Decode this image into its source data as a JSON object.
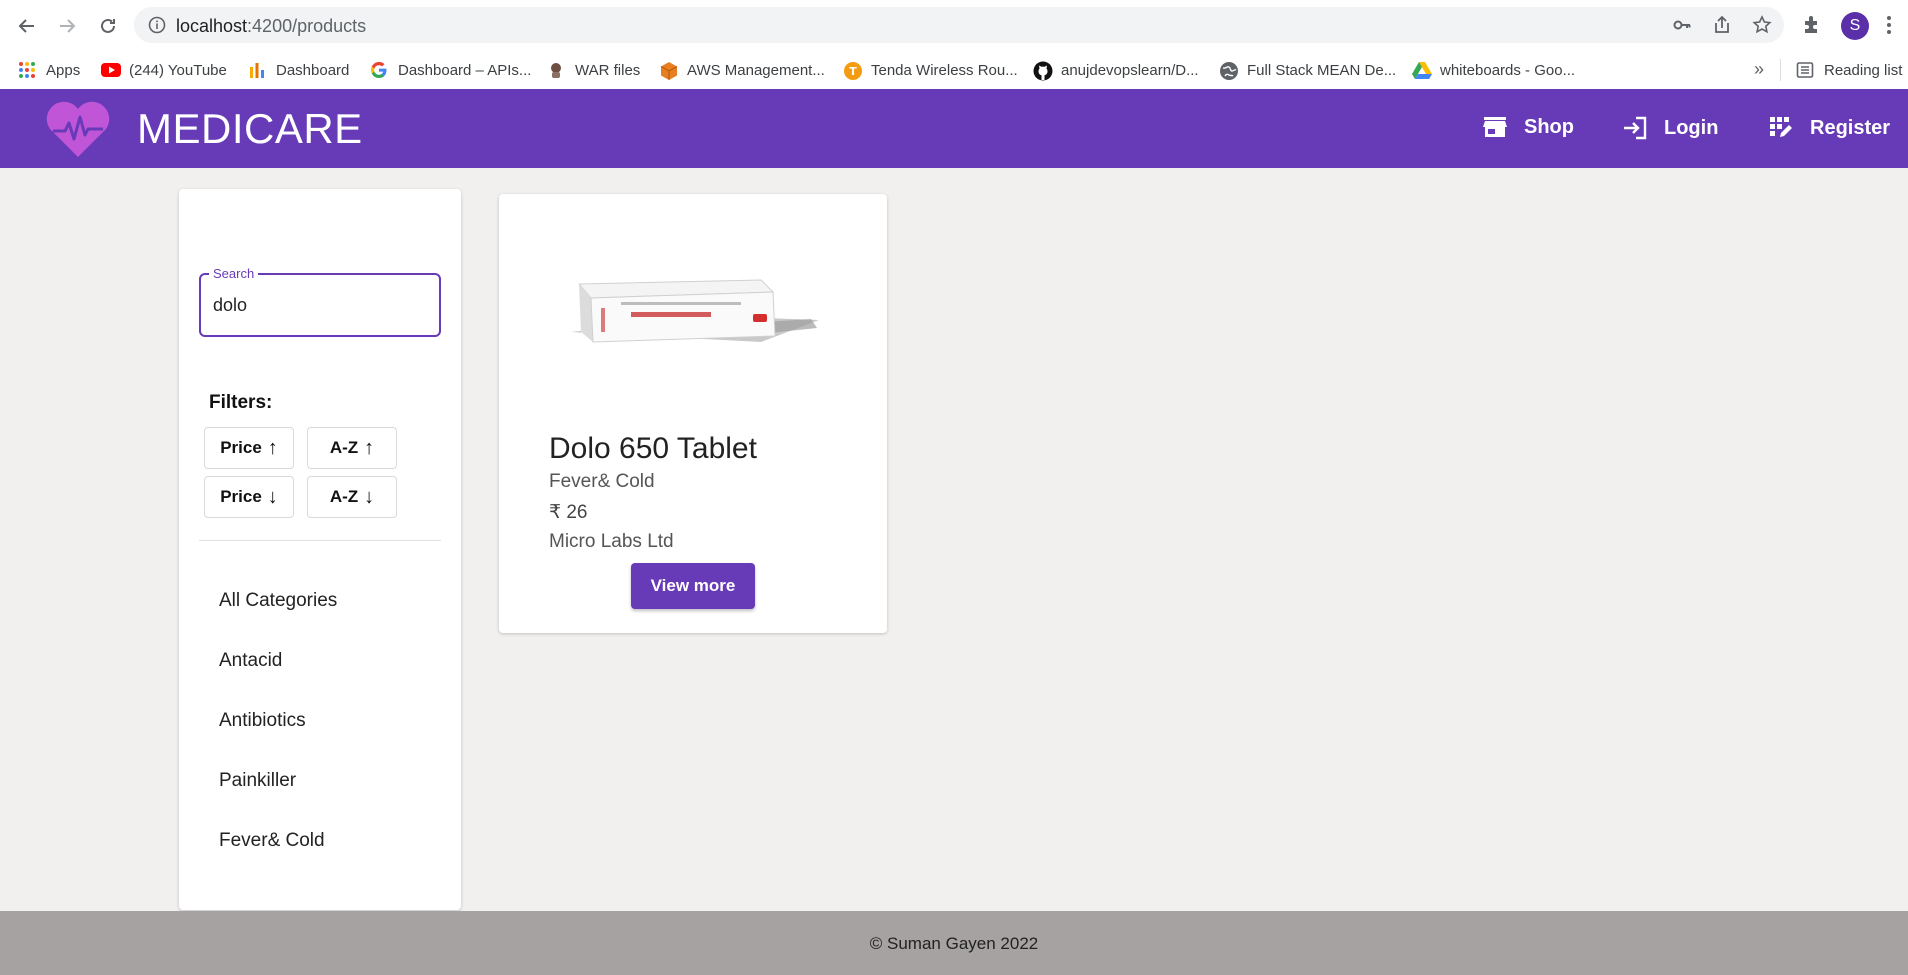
{
  "browser": {
    "url_host": "localhost",
    "url_path": ":4200/products",
    "bookmarks": [
      {
        "label": "Apps",
        "icon": "apps-grid-icon"
      },
      {
        "label": "(244) YouTube",
        "icon": "youtube-icon"
      },
      {
        "label": "Dashboard",
        "icon": "dashboard-icon"
      },
      {
        "label": "Dashboard – APIs...",
        "icon": "google-icon"
      },
      {
        "label": "WAR files",
        "icon": "war-files-icon"
      },
      {
        "label": "AWS Management...",
        "icon": "aws-icon"
      },
      {
        "label": "Tenda Wireless Rou...",
        "icon": "tenda-icon"
      },
      {
        "label": "anujdevopslearn/D...",
        "icon": "github-icon"
      },
      {
        "label": "Full Stack MEAN De...",
        "icon": "globe-icon"
      },
      {
        "label": "whiteboards - Goo...",
        "icon": "google-drive-icon"
      }
    ],
    "more_bookmarks": "»",
    "reading_list": "Reading list",
    "profile_initial": "S"
  },
  "header": {
    "brand": "MEDICARE",
    "nav": {
      "shop": "Shop",
      "login": "Login",
      "register": "Register"
    },
    "accent_color": "#673ab7",
    "logo_color": "#c155d8"
  },
  "sidebar": {
    "search_label": "Search",
    "search_value": "dolo",
    "filters_title": "Filters:",
    "filter_buttons": [
      {
        "label": "Price",
        "arrow": "↑"
      },
      {
        "label": "A-Z",
        "arrow": "↑"
      },
      {
        "label": "Price",
        "arrow": "↓"
      },
      {
        "label": "A-Z",
        "arrow": "↓"
      }
    ],
    "categories": [
      "All Categories",
      "Antacid",
      "Antibiotics",
      "Painkiller",
      "Fever& Cold"
    ]
  },
  "products": [
    {
      "name": "Dolo 650 Tablet",
      "category": "Fever& Cold",
      "price": "₹ 26",
      "manufacturer": "Micro Labs Ltd",
      "button": "View more"
    }
  ],
  "footer": {
    "text": "© Suman Gayen 2022"
  }
}
